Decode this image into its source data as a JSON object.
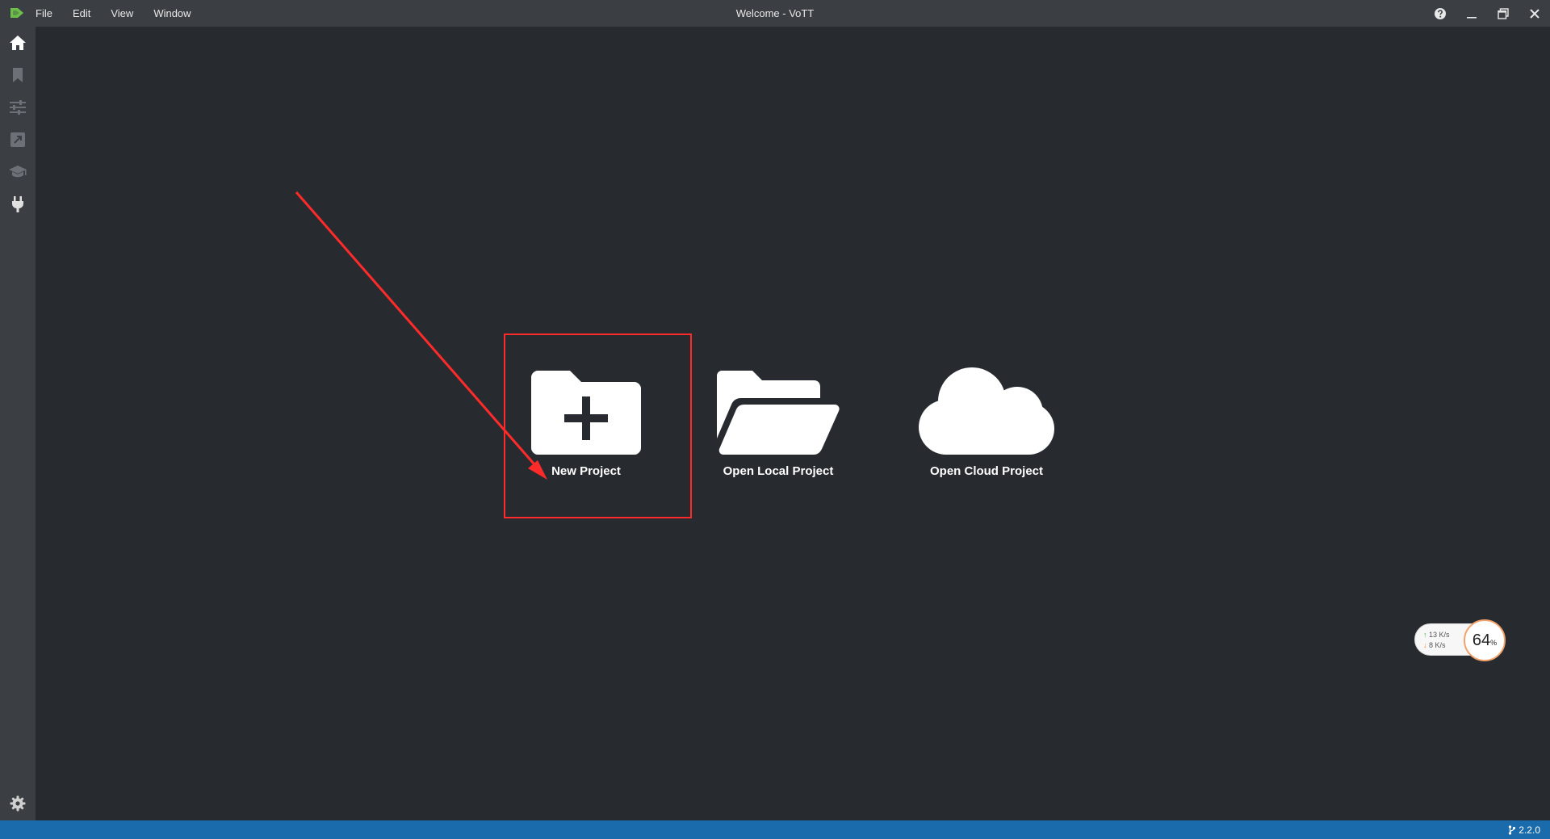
{
  "window": {
    "title": "Welcome - VoTT"
  },
  "menu": {
    "items": [
      "File",
      "Edit",
      "View",
      "Window"
    ]
  },
  "sidebar": {
    "items": [
      {
        "name": "home",
        "active": true
      },
      {
        "name": "bookmark",
        "active": false
      },
      {
        "name": "settings-sliders",
        "active": false
      },
      {
        "name": "export",
        "active": false
      },
      {
        "name": "active-learning",
        "active": false
      },
      {
        "name": "connections",
        "active": false
      }
    ],
    "bottom": {
      "name": "app-settings"
    }
  },
  "actions": {
    "new_project": "New Project",
    "open_local": "Open Local Project",
    "open_cloud": "Open Cloud Project"
  },
  "status": {
    "version": "2.2.0"
  },
  "network": {
    "up": "13 K/s",
    "down": "8 K/s",
    "percent": "64",
    "percent_unit": "%"
  },
  "colors": {
    "background": "#272b30",
    "chrome": "#3b3f44",
    "statusbar": "#1a6bab",
    "logo": "#6cc04a",
    "annotation": "#ff2a2a"
  }
}
